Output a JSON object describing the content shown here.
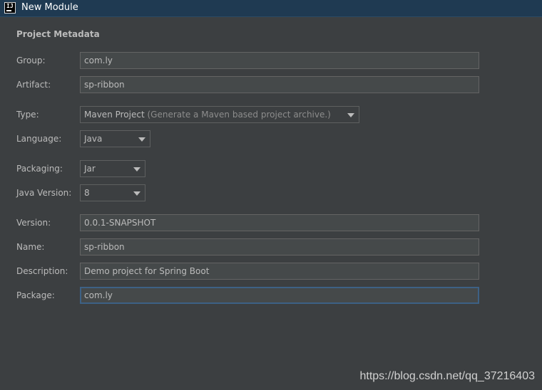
{
  "window": {
    "title": "New Module",
    "icon_text": "IJ"
  },
  "section": {
    "title": "Project Metadata"
  },
  "fields": {
    "group": {
      "label": "Group:",
      "value": "com.ly"
    },
    "artifact": {
      "label": "Artifact:",
      "value": "sp-ribbon"
    },
    "type": {
      "label": "Type:",
      "value": "Maven Project",
      "hint": "(Generate a Maven based project archive.)"
    },
    "language": {
      "label": "Language:",
      "value": "Java"
    },
    "packaging": {
      "label": "Packaging:",
      "value": "Jar"
    },
    "java_version": {
      "label": "Java Version:",
      "value": "8"
    },
    "version": {
      "label": "Version:",
      "value": "0.0.1-SNAPSHOT"
    },
    "name": {
      "label": "Name:",
      "value": "sp-ribbon"
    },
    "description": {
      "label": "Description:",
      "value": "Demo project for Spring Boot"
    },
    "package": {
      "label": "Package:",
      "value": "com.ly"
    }
  },
  "watermark": "https://blog.csdn.net/qq_37216403",
  "icons": {
    "app": "intellij-idea-icon",
    "dropdown": "chevron-down-icon"
  },
  "colors": {
    "background": "#3c3f41",
    "titlebar": "#1f3a52",
    "text": "#bbbbbb",
    "field_bg": "#45494a",
    "focus_border": "#3d6185"
  }
}
